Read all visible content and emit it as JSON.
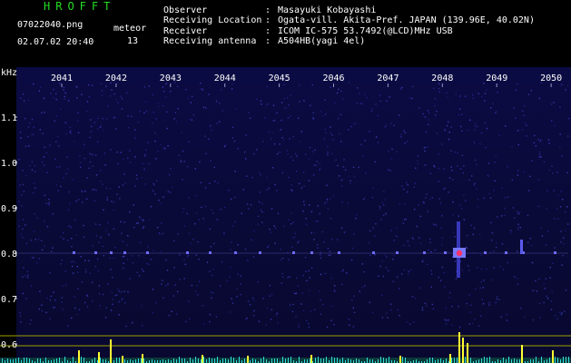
{
  "header": {
    "app_title": "HROFFT",
    "filename": "07022040.png",
    "datetime": "02.07.02 20:40",
    "meteor_label": "meteor",
    "meteor_count": "13",
    "info": [
      {
        "label": "Observer",
        "value": "Masayuki Kobayashi"
      },
      {
        "label": "Receiving Location",
        "value": "Ogata-vill. Akita-Pref. JAPAN (139.96E, 40.02N)"
      },
      {
        "label": "Receiver",
        "value": "ICOM IC-575 53.7492(@LCD)MHz USB"
      },
      {
        "label": "Receiving antenna",
        "value": "A504HB(yagi 4el)"
      }
    ]
  },
  "spectrogram": {
    "y_unit": "kHz",
    "y_ticks": [
      "1.1",
      "1.0",
      "0.9",
      "0.8",
      "0.7",
      "0.6"
    ],
    "time_ticks": [
      "2041",
      "2042",
      "2043",
      "2044",
      "2045",
      "2046",
      "2047",
      "2048",
      "2049",
      "2050"
    ],
    "colors": {
      "background": "#0a0a3a",
      "echo": "#6c6cff",
      "echo_core": "#ff3366",
      "yellow": "#ffff33",
      "cyan": "#33dddd",
      "tick_text": "#ffffff"
    }
  }
}
